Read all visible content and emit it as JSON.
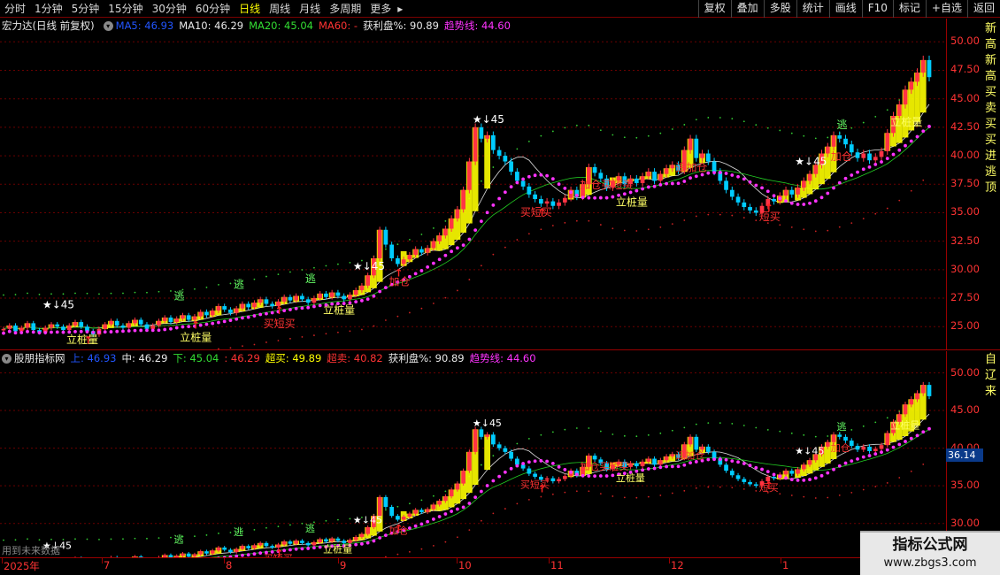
{
  "toolbar": {
    "left_items": [
      "分时",
      "1分钟",
      "5分钟",
      "15分钟",
      "30分钟",
      "60分钟",
      "日线",
      "周线",
      "月线",
      "多周期",
      "更多"
    ],
    "active_index": 6,
    "more_arrow": "▸",
    "right_buttons": [
      "复权",
      "叠加",
      "多股",
      "统计",
      "画线",
      "F10",
      "标记",
      "+自选",
      "返回"
    ]
  },
  "main_legend": {
    "title": "宏力达(日线 前复权)",
    "ma5": "MA5: 46.93",
    "ma10": "MA10: 46.29",
    "ma20": "MA20: 45.04",
    "ma60": "MA60: -",
    "profit": "获利盘%: 90.89",
    "trend": "趋势线: 44.60"
  },
  "sub_legend": {
    "title": "股朋指标网",
    "up": "上: 46.93",
    "mid": "中: 46.29",
    "low": "下: 45.04",
    "v4": ": 46.29",
    "overbuy": "超买: 49.89",
    "oversell": "超卖: 40.82",
    "profit": "获利盘%: 90.89",
    "trend": "趋势线: 44.60"
  },
  "main_axis": [
    "50.00",
    "47.50",
    "45.00",
    "42.50",
    "40.00",
    "37.50",
    "35.00",
    "32.50",
    "30.00",
    "27.50",
    "25.00"
  ],
  "sub_axis": [
    "50.00",
    "45.00",
    "40.00",
    "35.00",
    "30.00"
  ],
  "price_tag": "36.14",
  "future_note": "用到未来数据",
  "date_labels": [
    "2025年",
    "7",
    "8",
    "9",
    "10",
    "11",
    "12",
    "1"
  ],
  "side_text_main": "新高新高买卖买买进逃顶",
  "side_text_sub": "自辽来",
  "watermark": {
    "title": "指标公式网",
    "url": "www.zbgs3.com"
  },
  "colors": {
    "up": "#ff3344",
    "down": "#00ccff",
    "yellow": "#ffff00",
    "green_dot": "#33cc33",
    "red_dot": "#cc2222",
    "magenta": "#ff33ff"
  },
  "chart_data": {
    "type": "candlestick",
    "ylim_main": [
      23.0,
      50.8
    ],
    "ylim_sub": [
      25.5,
      51.0
    ],
    "closes": [
      24.8,
      25.1,
      24.6,
      24.9,
      25.3,
      24.7,
      24.5,
      24.9,
      25.2,
      25.0,
      24.7,
      25.1,
      25.4,
      25.0,
      24.6,
      24.3,
      24.8,
      25.2,
      25.5,
      25.1,
      24.9,
      25.3,
      25.6,
      25.2,
      24.8,
      25.1,
      25.5,
      25.8,
      25.4,
      25.7,
      26.0,
      25.6,
      25.9,
      26.3,
      26.0,
      26.4,
      26.8,
      26.5,
      26.2,
      26.6,
      27.0,
      26.7,
      27.1,
      27.4,
      27.0,
      26.8,
      27.2,
      27.6,
      27.3,
      27.7,
      27.4,
      27.1,
      27.5,
      27.9,
      27.6,
      28.0,
      27.7,
      27.4,
      27.8,
      28.2,
      28.6,
      29.5,
      31.0,
      33.5,
      32.2,
      31.0,
      30.5,
      30.9,
      31.3,
      31.8,
      31.5,
      31.9,
      32.5,
      33.0,
      33.6,
      34.5,
      35.3,
      37.0,
      39.5,
      42.5,
      41.5,
      41.8,
      40.5,
      40.0,
      39.5,
      38.6,
      37.8,
      37.3,
      36.6,
      36.2,
      35.8,
      36.0,
      35.6,
      35.9,
      36.3,
      37.0,
      36.4,
      37.5,
      39.0,
      38.5,
      38.0,
      37.2,
      37.8,
      38.2,
      37.5,
      38.0,
      37.6,
      38.2,
      38.6,
      37.8,
      38.4,
      38.9,
      39.2,
      38.7,
      40.5,
      41.5,
      39.8,
      40.2,
      39.5,
      38.6,
      37.8,
      37.0,
      36.4,
      35.9,
      35.5,
      35.2,
      35.0,
      35.6,
      36.2,
      36.0,
      36.5,
      37.0,
      36.6,
      37.2,
      37.8,
      38.4,
      39.2,
      40.2,
      40.8,
      41.8,
      41.5,
      41.0,
      40.3,
      39.8,
      40.2,
      39.6,
      39.9,
      40.4,
      42.0,
      43.5,
      44.5,
      45.8,
      46.5,
      47.3,
      48.4,
      46.9
    ]
  }
}
